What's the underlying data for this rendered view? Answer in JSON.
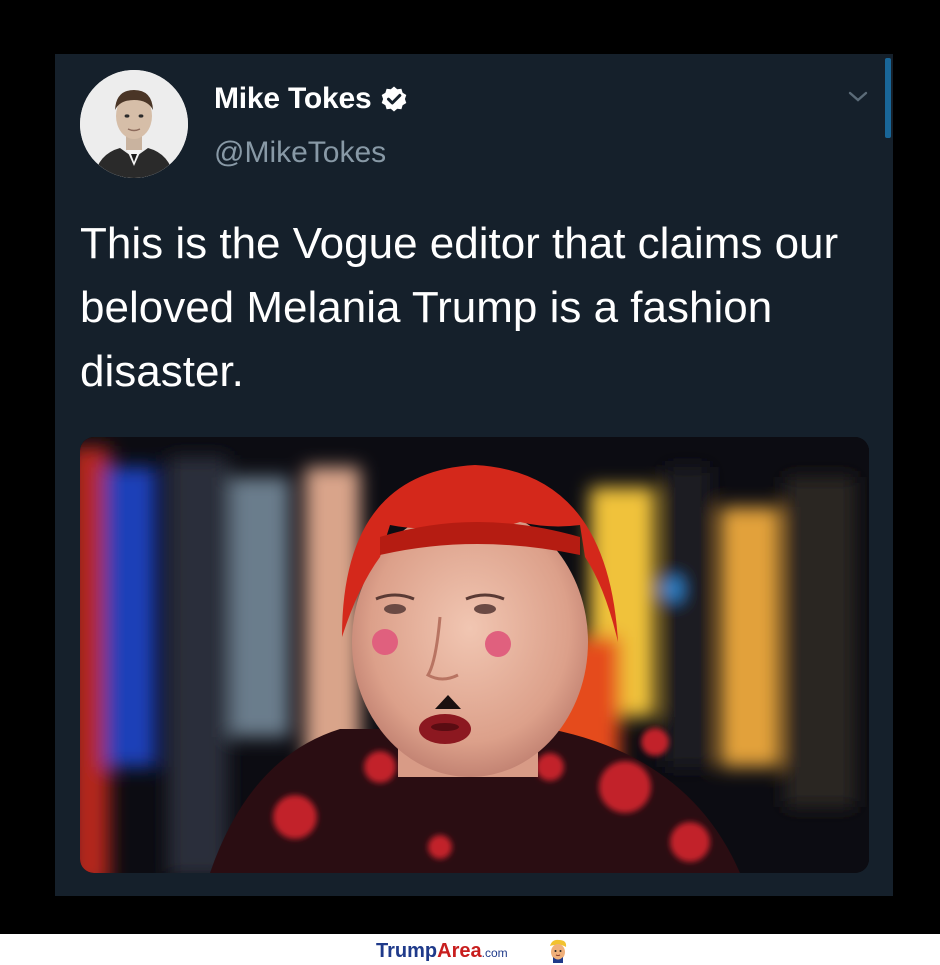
{
  "tweet": {
    "display_name": "Mike Tokes",
    "handle": "@MikeTokes",
    "verified": true,
    "text": "This is the Vogue editor that claims our beloved Melania Trump is a fashion disaster.",
    "avatar_icon": "user-portrait",
    "menu_icon": "chevron-down-icon",
    "media_icon": "photo-portrait-red-hair"
  },
  "footer": {
    "brand_part1": "Trump",
    "brand_part2": "Area",
    "brand_suffix": ".com",
    "mascot_icon": "trump-mascot-icon"
  },
  "colors": {
    "background": "#000000",
    "card": "#15202b",
    "handle_text": "#8899a6",
    "verified_badge": "#ffffff",
    "brand_blue": "#1f3a8a",
    "brand_red": "#c81e1e"
  }
}
